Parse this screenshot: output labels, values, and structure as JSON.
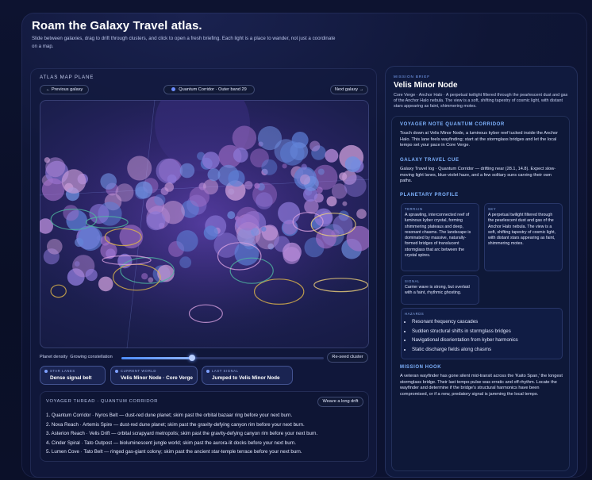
{
  "header": {
    "title": "Roam the Galaxy Travel atlas.",
    "subtitle": "Slide between galaxies, drag to drift through clusters, and click to open a fresh briefing. Each light is a place to wander, not just a coordinate on a map."
  },
  "atlas": {
    "heading": "ATLAS MAP PLANE",
    "prev_label": "← Previous galaxy",
    "next_label": "Next galaxy →",
    "band_label": "Quantum Corridor · Outer band 29",
    "density_label": "Planet density",
    "density_mode": "Growing constellation",
    "density_value": 0.35,
    "reseed_label": "Re-seed cluster"
  },
  "stats": [
    {
      "key": "STAR LANES",
      "value": "Dense signal belt"
    },
    {
      "key": "CURRENT WORLD",
      "value": "Velis Minor Node · Core Verge"
    },
    {
      "key": "LAST SIGNAL",
      "value": "Jumped to Velis Minor Node"
    }
  ],
  "thread": {
    "heading": "VOYAGER THREAD · QUANTUM CORRIDOR",
    "weave_label": "Weave a long drift",
    "items": [
      "1. Quantum Corridor · Nyros Belt — dust-red dune planet; skim past the orbital bazaar ring before your next burn.",
      "2. Nova Reach · Artemis Spire — dust-red dune planet; skim past the gravity-defying canyon rim before your next burn.",
      "3. Asterion Reach · Velis Drift — orbital scrapyard metropolis; skim past the gravity-defying canyon rim before your next burn.",
      "4. Cinder Spiral · Tato Outpost — bioluminescent jungle world; skim past the aurora-lit docks before your next burn.",
      "5. Lumen Cove · Tato Belt — ringed gas-giant colony; skim past the ancient star-temple terrace before your next burn."
    ]
  },
  "brief": {
    "heading": "MISSION BRIEF",
    "title": "Velis Minor Node",
    "summary": "Core Verge · Anchor Halo · A perpetual twilight filtered through the pearlescent dust and gas of the Anchor Halo nebula. The view is a soft, shifting tapestry of cosmic light, with distant stars appearing as faint, shimmering motes.",
    "voyager_title": "VOYAGER NOTE QUANTUM CORRIDOR",
    "voyager_body": "Touch down at Velis Minor Node, a luminous kyber reef tucked inside the Anchor Halo. This lane feels wayfinding; start at the stormglass bridges and let the local tempo set your pace in Core Verge.",
    "cue_title": "GALAXY TRAVEL CUE",
    "cue_body": "Galaxy Travel log · Quantum Corridor — drifting near (28.1, 14.8). Expect slow-moving light lanes, blue-violet haze, and a few solitary suns carving their own paths.",
    "profile_title": "PLANETARY PROFILE",
    "terrain_key": "TERRAIN",
    "terrain_body": "A sprawling, interconnected reef of luminous kyber crystal, forming shimmering plateaus and deep, resonant chasms. The landscape is dominated by massive, naturally-formed bridges of translucent stormglass that arc between the crystal spires.",
    "sky_key": "SKY",
    "sky_body": "A perpetual twilight filtered through the pearlescent dust and gas of the Anchor Halo nebula. The view is a soft, shifting tapestry of cosmic light, with distant stars appearing as faint, shimmering motes.",
    "signal_key": "SIGNAL",
    "signal_body": "Carrier wave is strong, but overlaid with a faint, rhythmic ghosting.",
    "hazards_key": "HAZARDS",
    "hazards": [
      "Resonant frequency cascades",
      "Sudden structural shifts in stormglass bridges",
      "Navigational disorientation from kyber harmonics",
      "Static discharge fields along chasms"
    ],
    "hook_title": "MISSION HOOK",
    "hook_body": "A veteran wayfinder has gone silent mid-transit across the 'Kaito Span,' the longest stormglass bridge. Their last tempo-pulse was erratic and off-rhythm. Locate the wayfinder and determine if the bridge's structural harmonics have been compromised, or if a new, predatory signal is jamming the local tempo."
  },
  "colors": {
    "accent": "#7fb3ff",
    "planet_violet": "#b58ad8",
    "planet_blue": "#6f8fe0",
    "orbit_gold": "#e0b64a",
    "orbit_teal": "#4fb6a0"
  }
}
